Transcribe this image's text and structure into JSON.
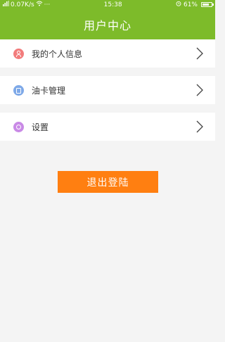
{
  "status_bar": {
    "network_speed": "0.07K/s",
    "more": "···",
    "time": "15:38",
    "battery": "61%"
  },
  "header": {
    "title": "用户中心"
  },
  "menu": [
    {
      "label": "我的个人信息",
      "icon": "user-info-icon",
      "color": "#f27c7c"
    },
    {
      "label": "油卡管理",
      "icon": "fuel-card-icon",
      "color": "#7ea9e8"
    },
    {
      "label": "设置",
      "icon": "settings-icon",
      "color": "#c98ae6"
    }
  ],
  "logout": {
    "label": "退出登陆"
  },
  "colors": {
    "primary": "#7dbb2a",
    "accent": "#ff7f11",
    "background": "#f4f4f4"
  }
}
